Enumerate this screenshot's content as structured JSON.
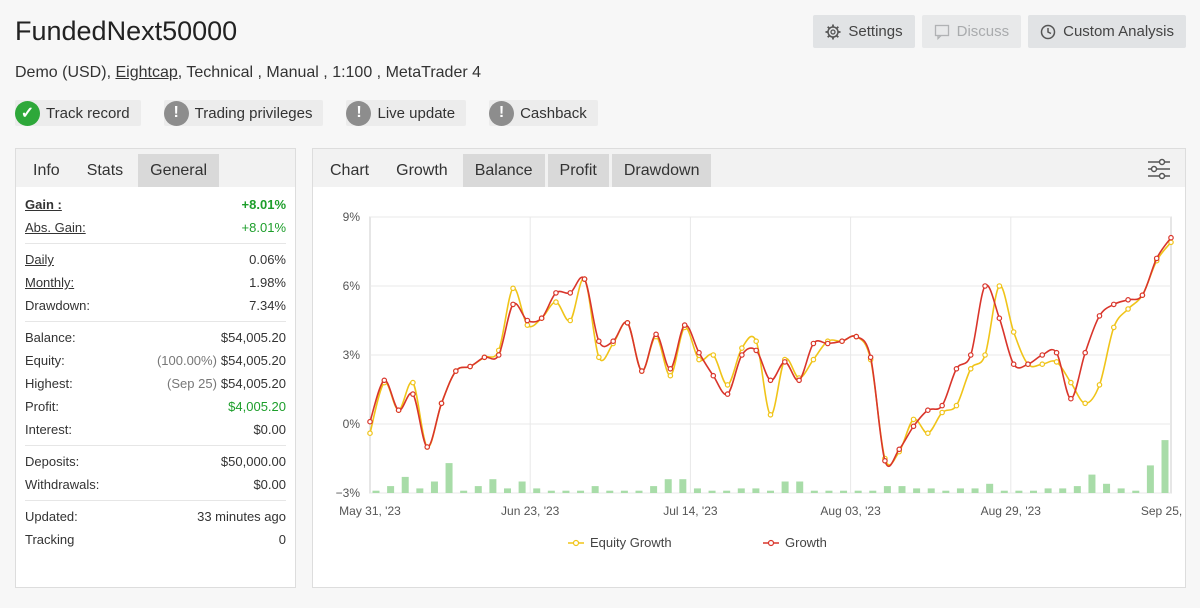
{
  "header": {
    "title": "FundedNext50000",
    "subtitle_prefix": "Demo (USD),",
    "broker": "Eightcap",
    "subtitle_suffix": ", Technical , Manual , 1:100 , MetaTrader 4"
  },
  "top_buttons": {
    "settings": "Settings",
    "discuss": "Discuss",
    "custom_analysis": "Custom Analysis"
  },
  "badges": {
    "track_record": "Track record",
    "trading_privileges": "Trading privileges",
    "live_update": "Live update",
    "cashback": "Cashback"
  },
  "left_tabs": {
    "info": "Info",
    "stats": "Stats",
    "general": "General"
  },
  "stats": {
    "gain_label": "Gain :",
    "gain_value": "+8.01%",
    "abs_gain_label": "Abs. Gain:",
    "abs_gain_value": "+8.01%",
    "daily_label": "Daily",
    "daily_value": "0.06%",
    "monthly_label": "Monthly:",
    "monthly_value": "1.98%",
    "drawdown_label": "Drawdown:",
    "drawdown_value": "7.34%",
    "balance_label": "Balance:",
    "balance_value": "$54,005.20",
    "equity_label": "Equity:",
    "equity_pct": "(100.00%)",
    "equity_value": "$54,005.20",
    "highest_label": "Highest:",
    "highest_date": "(Sep 25)",
    "highest_value": "$54,005.20",
    "profit_label": "Profit:",
    "profit_value": "$4,005.20",
    "interest_label": "Interest:",
    "interest_value": "$0.00",
    "deposits_label": "Deposits:",
    "deposits_value": "$50,000.00",
    "withdrawals_label": "Withdrawals:",
    "withdrawals_value": "$0.00",
    "updated_label": "Updated:",
    "updated_value": "33 minutes ago",
    "tracking_label": "Tracking",
    "tracking_value": "0"
  },
  "chart_tabs": {
    "chart": "Chart",
    "growth": "Growth",
    "balance": "Balance",
    "profit": "Profit",
    "drawdown": "Drawdown"
  },
  "colors": {
    "equity": "#f0c419",
    "growth": "#d9352b",
    "bars": "#a8dca8",
    "green": "#1d9e2b"
  },
  "chart_data": {
    "type": "line",
    "ylabel": "",
    "ylim": [
      -3,
      9
    ],
    "y_ticks": [
      "9%",
      "6%",
      "3%",
      "0%",
      "−3%"
    ],
    "y_tick_values": [
      9,
      6,
      3,
      0,
      -3
    ],
    "x_ticks": [
      "May 31, '23",
      "Jun 23, '23",
      "Jul 14, '23",
      "Aug 03, '23",
      "Aug 29, '23",
      "Sep 25, '23"
    ],
    "legend": [
      "Equity Growth",
      "Growth"
    ],
    "legend_position": "bottom",
    "grid": true,
    "series": [
      {
        "name": "Equity Growth",
        "values": [
          -0.4,
          1.8,
          0.6,
          1.8,
          -1.0,
          0.9,
          2.3,
          2.5,
          2.9,
          3.2,
          5.9,
          4.3,
          4.6,
          5.3,
          4.5,
          6.3,
          2.9,
          3.5,
          4.4,
          2.3,
          3.8,
          2.1,
          4.2,
          2.8,
          3.0,
          1.7,
          3.3,
          3.6,
          0.4,
          2.8,
          2.0,
          2.8,
          3.6,
          3.6,
          3.8,
          2.8,
          -1.5,
          -1.2,
          0.2,
          -0.4,
          0.5,
          0.8,
          2.4,
          3.0,
          6.0,
          4.0,
          2.6,
          2.6,
          2.7,
          1.8,
          0.9,
          1.7,
          4.2,
          5.0,
          5.6,
          7.1,
          7.9
        ],
        "color": "#f0c419"
      },
      {
        "name": "Growth",
        "values": [
          0.1,
          1.9,
          0.6,
          1.3,
          -1.0,
          0.9,
          2.3,
          2.5,
          2.9,
          3.0,
          5.2,
          4.5,
          4.6,
          5.7,
          5.7,
          6.3,
          3.6,
          3.6,
          4.4,
          2.3,
          3.9,
          2.4,
          4.3,
          3.1,
          2.1,
          1.3,
          3.0,
          3.2,
          1.9,
          2.7,
          1.9,
          3.5,
          3.5,
          3.6,
          3.8,
          2.9,
          -1.6,
          -1.1,
          -0.1,
          0.6,
          0.8,
          2.4,
          3.0,
          6.0,
          4.6,
          2.6,
          2.6,
          3.0,
          3.1,
          1.1,
          3.1,
          4.7,
          5.2,
          5.4,
          5.6,
          7.2,
          8.1
        ],
        "color": "#d9352b"
      },
      {
        "name": "bars",
        "values": [
          0.1,
          0.3,
          0.7,
          0.2,
          0.5,
          1.3,
          0.1,
          0.3,
          0.6,
          0.2,
          0.5,
          0.2,
          0.1,
          0.1,
          0.1,
          0.3,
          0.1,
          0.1,
          0.1,
          0.3,
          0.6,
          0.6,
          0.2,
          0.1,
          0.1,
          0.2,
          0.2,
          0.1,
          0.5,
          0.5,
          0.1,
          0.1,
          0.1,
          0.1,
          0.1,
          0.3,
          0.3,
          0.2,
          0.2,
          0.1,
          0.2,
          0.2,
          0.4,
          0.1,
          0.1,
          0.1,
          0.2,
          0.2,
          0.3,
          0.8,
          0.4,
          0.2,
          0.1,
          1.2,
          2.3
        ],
        "color": "#a8dca8"
      }
    ]
  }
}
